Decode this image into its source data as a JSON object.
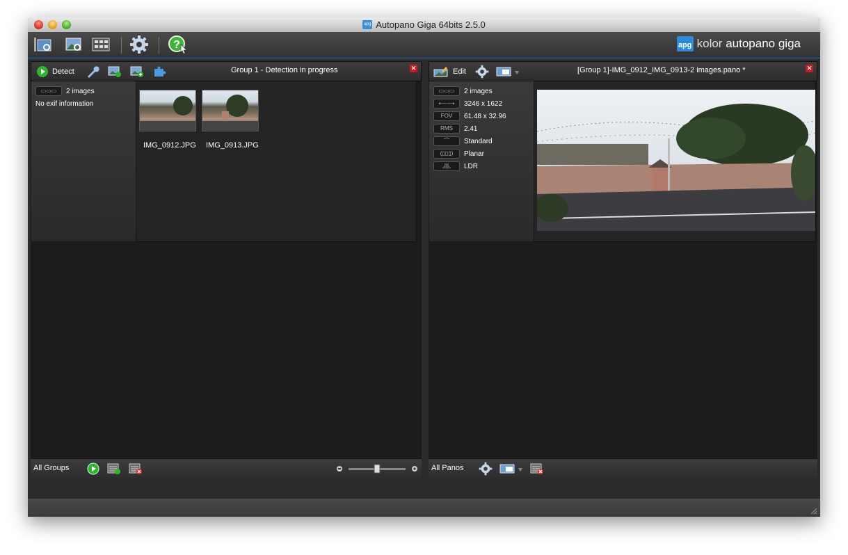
{
  "window": {
    "title": "Autopano Giga 64bits 2.5.0",
    "title_icon": "apg"
  },
  "brand": {
    "logo": "apg",
    "word1": "kolor",
    "word2": "autopano giga"
  },
  "toolbar": {
    "icons": [
      "open-group-icon",
      "open-images-icon",
      "batch-icon",
      "settings-gear-icon",
      "help-icon"
    ]
  },
  "groups_panel": {
    "detect_label": "Detect",
    "header_title": "Group 1 - Detection in progress",
    "info": {
      "images_count": "2 images",
      "exif": "No exif information"
    },
    "thumbnails": [
      {
        "name": "IMG_0912.JPG"
      },
      {
        "name": "IMG_0913.JPG"
      }
    ],
    "footer_label": "All Groups"
  },
  "panos_panel": {
    "edit_label": "Edit",
    "header_title": "[Group 1]-IMG_0912_IMG_0913-2 images.pano *",
    "info": [
      {
        "badge": "",
        "icon": "images-icon",
        "value": "2 images"
      },
      {
        "badge": "",
        "icon": "size-icon",
        "value": "3246 x 1622"
      },
      {
        "badge": "FOV",
        "icon": "fov-icon",
        "value": "61.48 x 32.96"
      },
      {
        "badge": "RMS",
        "icon": "rms-icon",
        "value": "2.41"
      },
      {
        "badge": "",
        "icon": "projection-icon",
        "value": "Standard"
      },
      {
        "badge": "",
        "icon": "planar-icon",
        "value": "Planar"
      },
      {
        "badge": "",
        "icon": "ldr-icon",
        "value": "LDR"
      }
    ],
    "footer_label": "All Panos"
  },
  "zoom_slider": {
    "level": 0.5
  },
  "colors": {
    "accent": "#1a6fd0",
    "close_red": "#c8191d",
    "play_green": "#2fb52a"
  }
}
